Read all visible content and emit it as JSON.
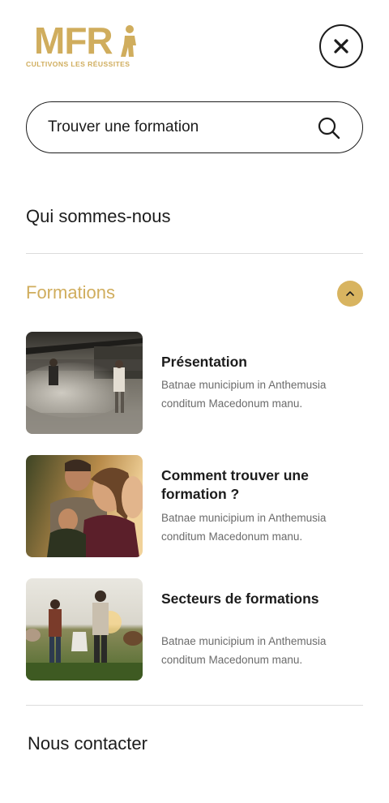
{
  "logo": {
    "mark": "MFR",
    "tagline": "CULTIVONS LES RÉUSSITES"
  },
  "search": {
    "placeholder": "Trouver une formation"
  },
  "nav": {
    "about": "Qui sommes-nous",
    "formations": {
      "title": "Formations",
      "items": [
        {
          "title": "Présentation",
          "description": "Batnae municipium in Anthemusia conditum Macedonum manu."
        },
        {
          "title": "Comment trouver une formation ?",
          "description": "Batnae municipium in Anthemusia conditum Macedonum manu."
        },
        {
          "title": "Secteurs de formations",
          "description": "Batnae municipium in Anthemusia conditum Macedonum manu."
        }
      ]
    },
    "contact": "Nous contacter"
  },
  "colors": {
    "accent": "#d0ad5d",
    "text": "#1c1c1c",
    "muted": "#6b6b6b",
    "divider": "#dcdcdc"
  },
  "icons": {
    "close": "close-icon",
    "search": "search-icon",
    "collapse": "chevron-up-icon"
  }
}
